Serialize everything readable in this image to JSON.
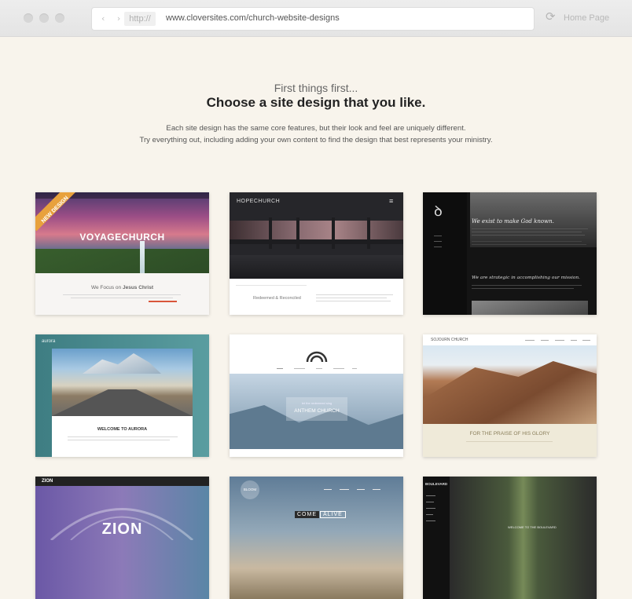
{
  "browser": {
    "nav_arrows": "‹ ›",
    "protocol": "http://",
    "url": "www.cloversites.com/church-website-designs",
    "reload_icon": "⟳",
    "home_label": "Home Page"
  },
  "intro": {
    "kicker": "First things first...",
    "title": "Choose a site design that you like.",
    "desc_line1": "Each site design has the same core features, but their look and feel are uniquely different.",
    "desc_line2": "Try everything out, including adding your own content to find the design that best represents your ministry."
  },
  "designs": {
    "voyage": {
      "ribbon": "NEW DESIGN",
      "name": "VOYAGECHURCH",
      "tagline_a": "We Focus on ",
      "tagline_b": "Jesus Christ"
    },
    "hope": {
      "logo": "HOPECHURCH",
      "menu": "≡",
      "caption": "Redeemed & Reconciled"
    },
    "script": {
      "logo": "ꝺ",
      "headline": "We exist to make God known.",
      "subhead": "We are strategic in accomplishing our mission."
    },
    "aurora": {
      "logo": "aurora",
      "welcome": "WELCOME TO AURORA"
    },
    "anthem": {
      "name": "ANTHEM CHURCH",
      "lead": "let the redeemed sing"
    },
    "sojourn": {
      "logo": "SOJOURN CHURCH",
      "band": "FOR THE PRAISE OF HIS GLORY"
    },
    "zion": {
      "logo": "ZION",
      "name": "ZION"
    },
    "bloom": {
      "logo": "BLOOM",
      "word1": "COME",
      "word2": "ALIVE"
    },
    "boulevard": {
      "logo": "BOULEVARD",
      "welcome": "WELCOME TO THE BOULEVARD"
    }
  },
  "colors": {
    "page_bg": "#f8f4ec",
    "accent_orange": "#e8a13c",
    "link_red": "#d9553a"
  }
}
